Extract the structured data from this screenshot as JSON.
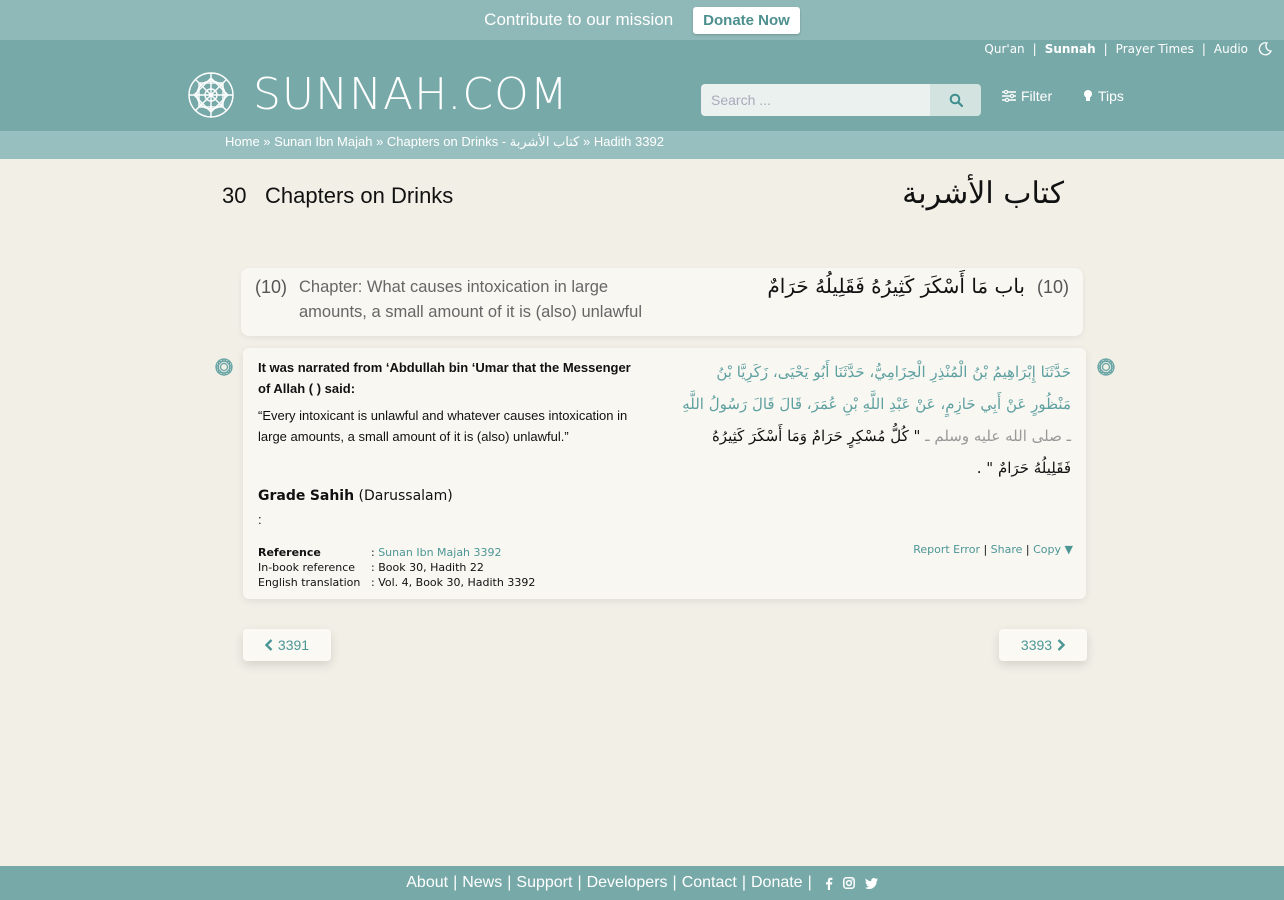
{
  "donate": {
    "text": "Contribute to our mission",
    "button": "Donate Now"
  },
  "top_nav": [
    "Qur'an",
    "Sunnah",
    "Prayer Times",
    "Audio"
  ],
  "logo_text": "SUNNAH.COM",
  "search": {
    "placeholder": "Search ..."
  },
  "header_links": {
    "filter": "Filter",
    "tips": "Tips"
  },
  "breadcrumb": [
    "Home",
    "Sunan Ibn Majah",
    "Chapters on Drinks - كتاب الأشربة",
    "Hadith 3392"
  ],
  "book": {
    "number": "30",
    "title": "Chapters on Drinks",
    "title_ar": "كتاب الأشربة"
  },
  "chapter": {
    "number": "(10)",
    "title": "Chapter: What causes intoxication in large amounts, a small amount of it is (also) unlawful",
    "number_ar": "(10)",
    "title_ar": "باب مَا أَسْكَرَ كَثِيرُهُ فَقَلِيلُهُ حَرَامٌ"
  },
  "hadith": {
    "narrator": "It was narrated from ‘Abdullah bin ‘Umar that the Messenger of Allah ( ) said:",
    "text": "“Every intoxicant is unlawful and whatever causes intoxication in large amounts, a small amount of it is (also) unlawful.”",
    "arabic_chain": "حَدَّثَنَا إِبْرَاهِيمُ بْنُ الْمُنْذِرِ الْحِزَامِيُّ، حَدَّثَنَا أَبُو يَحْيَى، زَكَرِيَّا بْنُ مَنْظُورٍ عَنْ أَبِي حَازِمٍ، عَنْ عَبْدِ اللَّهِ بْنِ عُمَرَ، قَالَ قَالَ رَسُولُ اللَّهِ ",
    "arabic_honorific": "ـ صلى الله عليه وسلم ـ ",
    "arabic_matn": "\" كُلُّ مُسْكِرٍ حَرَامٌ وَمَا أَسْكَرَ كَثِيرُهُ فَقَلِيلُهُ حَرَامٌ \" .",
    "grade_label": "Grade",
    "grade_value": "Sahih",
    "grade_source": "(Darussalam)",
    "grade_extra": ":"
  },
  "reference": {
    "ref_label": "Reference",
    "ref_value": "Sunan Ibn Majah 3392",
    "inbook_label": "In-book reference",
    "inbook_value": "Book 30, Hadith 22",
    "english_label": "English translation",
    "english_value": "Vol. 4, Book 30, Hadith 3392"
  },
  "actions": {
    "report": "Report Error",
    "share": "Share",
    "copy": "Copy"
  },
  "pagination": {
    "prev": "3391",
    "next": "3393"
  },
  "footer": [
    "About",
    "News",
    "Support",
    "Developers",
    "Contact",
    "Donate"
  ]
}
